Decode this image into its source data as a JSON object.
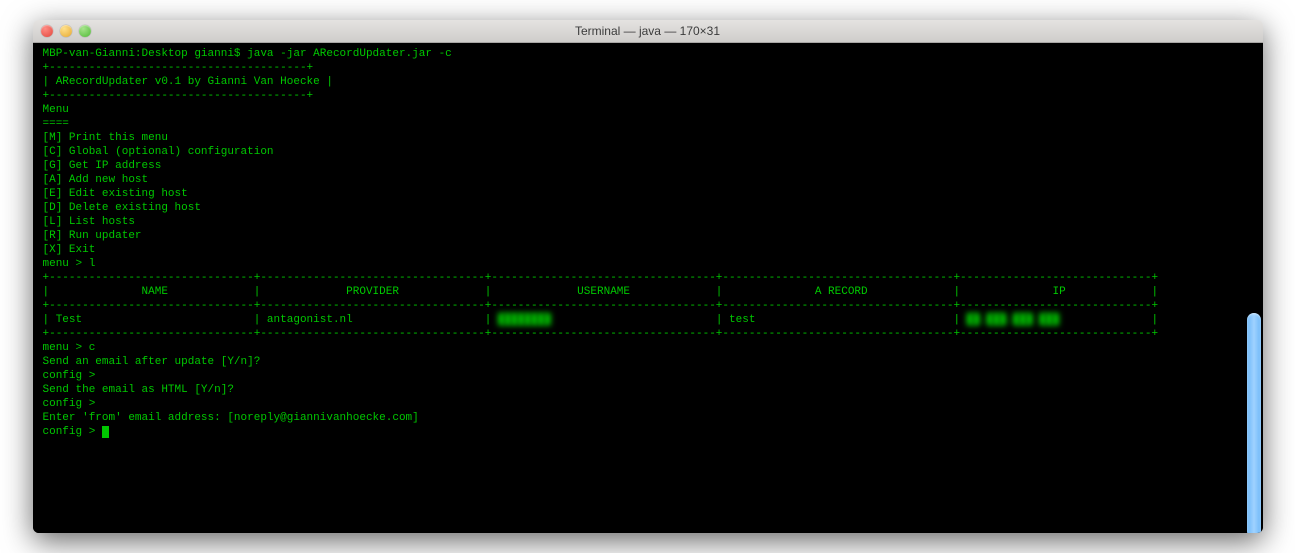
{
  "window": {
    "title": "Terminal — java — 170×31"
  },
  "term": {
    "prompt_line": "MBP-van-Gianni:Desktop gianni$ java -jar ARecordUpdater.jar -c",
    "box_border": "+---------------------------------------+",
    "box_content": "| ARecordUpdater v0.1 by Gianni Van Hoecke |",
    "blank": "",
    "menu_hdr": "Menu",
    "menu_sep": "====",
    "m0": "[M] Print this menu",
    "m1": "[C] Global (optional) configuration",
    "m2": "[G] Get IP address",
    "m3": "[A] Add new host",
    "m4": "[E] Edit existing host",
    "m5": "[D] Delete existing host",
    "m6": "[L] List hosts",
    "m7": "[R] Run updater",
    "m8": "[X] Exit",
    "menu_prompt1": "menu > l",
    "tbl_border": "+-------------------------------+----------------------------------+----------------------------------+-----------------------------------+-----------------------------+",
    "tbl_header": "|              NAME             |             PROVIDER             |             USERNAME             |              A RECORD             |              IP             |",
    "tbl_row_pre": "| Test                          | antagonist.nl                    | ",
    "tbl_row_user_blur": "████████",
    "tbl_row_mid": "                         | test                              | ",
    "tbl_row_ip_blur": "██.███.███ ███",
    "tbl_row_end": "              |",
    "menu_prompt2": "menu > c",
    "q1": "Send an email after update [Y/n]?",
    "cfg_prompt": "config > ",
    "q2": "Send the email as HTML [Y/n]?",
    "q3": "Enter 'from' email address: [noreply@giannivanhoecke.com]"
  }
}
